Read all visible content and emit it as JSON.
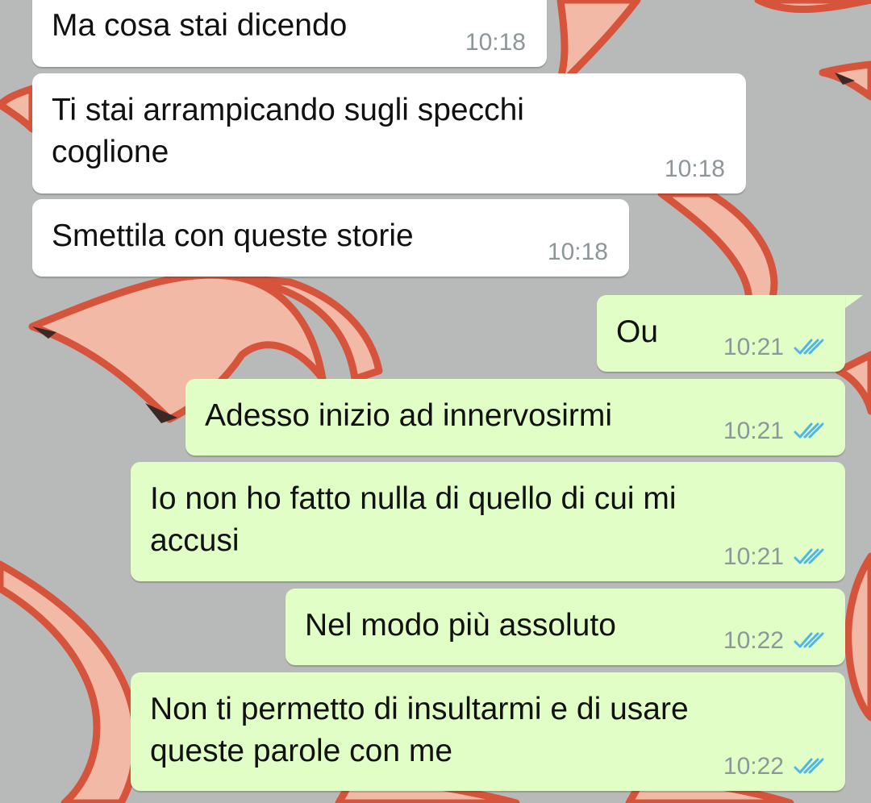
{
  "chat": {
    "messages": [
      {
        "direction": "incoming",
        "text": "Ma cosa stai dicendo",
        "time": "10:18"
      },
      {
        "direction": "incoming",
        "text": "Ti stai arrampicando sugli specchi\ncoglione",
        "time": "10:18"
      },
      {
        "direction": "incoming",
        "text": "Smettila con queste storie",
        "time": "10:18"
      },
      {
        "direction": "outgoing",
        "text": "Ou",
        "time": "10:21",
        "status": "read"
      },
      {
        "direction": "outgoing",
        "text": "Adesso inizio ad innervosirmi",
        "time": "10:21",
        "status": "read"
      },
      {
        "direction": "outgoing",
        "text": "Io non ho fatto nulla di quello di cui mi\naccusi",
        "time": "10:21",
        "status": "read"
      },
      {
        "direction": "outgoing",
        "text": "Nel modo più assoluto",
        "time": "10:22",
        "status": "read"
      },
      {
        "direction": "outgoing",
        "text": "Non ti permetto di insultarmi e di usare\nqueste parole con me",
        "time": "10:22",
        "status": "read"
      }
    ]
  },
  "icons": {
    "read_receipt": "double-check-icon"
  },
  "colors": {
    "incoming_bubble": "#ffffff",
    "outgoing_bubble": "#e1fec6",
    "timestamp": "#8d969a",
    "read_tick": "#4fb6ec",
    "wallpaper_base": "#b7b9b9",
    "flame_outline": "#d5543a",
    "flame_fill": "#f0b7a4"
  }
}
